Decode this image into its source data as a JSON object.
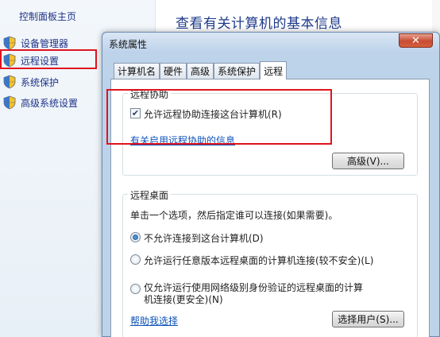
{
  "sidebar": {
    "title": "控制面板主页",
    "items": [
      {
        "label": "设备管理器",
        "icon": "shield-icon"
      },
      {
        "label": "远程设置",
        "icon": "shield-icon"
      },
      {
        "label": "系统保护",
        "icon": "shield-icon"
      },
      {
        "label": "高级系统设置",
        "icon": "shield-icon"
      }
    ]
  },
  "main": {
    "title": "查看有关计算机的基本信息"
  },
  "dialog": {
    "title": "系统属性",
    "close_glyph": "✕",
    "tabs": [
      {
        "label": "计算机名",
        "active": false
      },
      {
        "label": "硬件",
        "active": false
      },
      {
        "label": "高级",
        "active": false
      },
      {
        "label": "系统保护",
        "active": false
      },
      {
        "label": "远程",
        "active": true
      }
    ],
    "remote_assistance": {
      "legend": "远程协助",
      "allow_checkbox_label": "允许远程协助连接这台计算机(R)",
      "allow_checked": true,
      "info_link": "有关启用远程协助的信息",
      "advanced_button": "高级(V)..."
    },
    "remote_desktop": {
      "legend": "远程桌面",
      "instruction": "单击一个选项，然后指定谁可以连接(如果需要)。",
      "options": [
        {
          "label": "不允许连接到这台计算机(D)",
          "selected": true
        },
        {
          "label": "允许运行任意版本远程桌面的计算机连接(较不安全)(L)",
          "selected": false
        },
        {
          "label_line1": "仅允许运行使用网络级别身份验证的远程桌面的计算",
          "label_line2": "机连接(更安全)(N)",
          "selected": false
        }
      ],
      "help_link": "帮助我选择",
      "select_users_button": "选择用户(S)..."
    }
  },
  "colors": {
    "highlight": "#e0141e",
    "link": "#0c52b8",
    "sidebar_text": "#1e3287",
    "title_text": "#1e3a8a"
  }
}
